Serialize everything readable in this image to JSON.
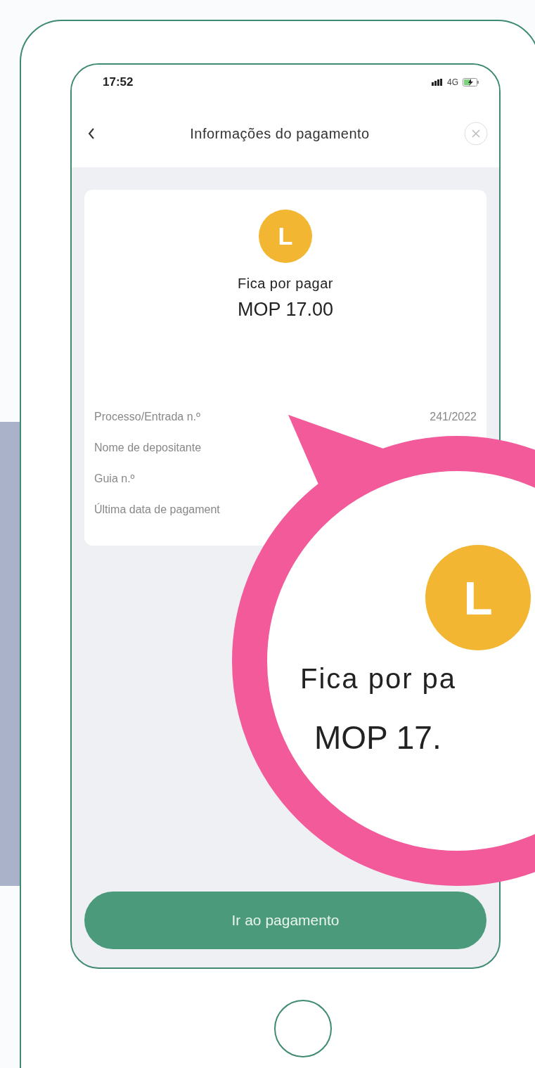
{
  "status_bar": {
    "time": "17:52",
    "network": "4G"
  },
  "nav": {
    "title": "Informações do pagamento"
  },
  "summary": {
    "badge_letter": "L",
    "label": "Fica por pagar",
    "amount": "MOP 17.00"
  },
  "details": [
    {
      "label": "Processo/Entrada n.º",
      "value": "241/2022"
    },
    {
      "label": "Nome de depositante"
    },
    {
      "label": "Guia n.º"
    },
    {
      "label": "Última data de pagament"
    }
  ],
  "button": {
    "label": "Ir ao pagamento"
  },
  "magnifier": {
    "badge_letter": "L",
    "label": "Fica por pa",
    "amount": "MOP 17."
  }
}
